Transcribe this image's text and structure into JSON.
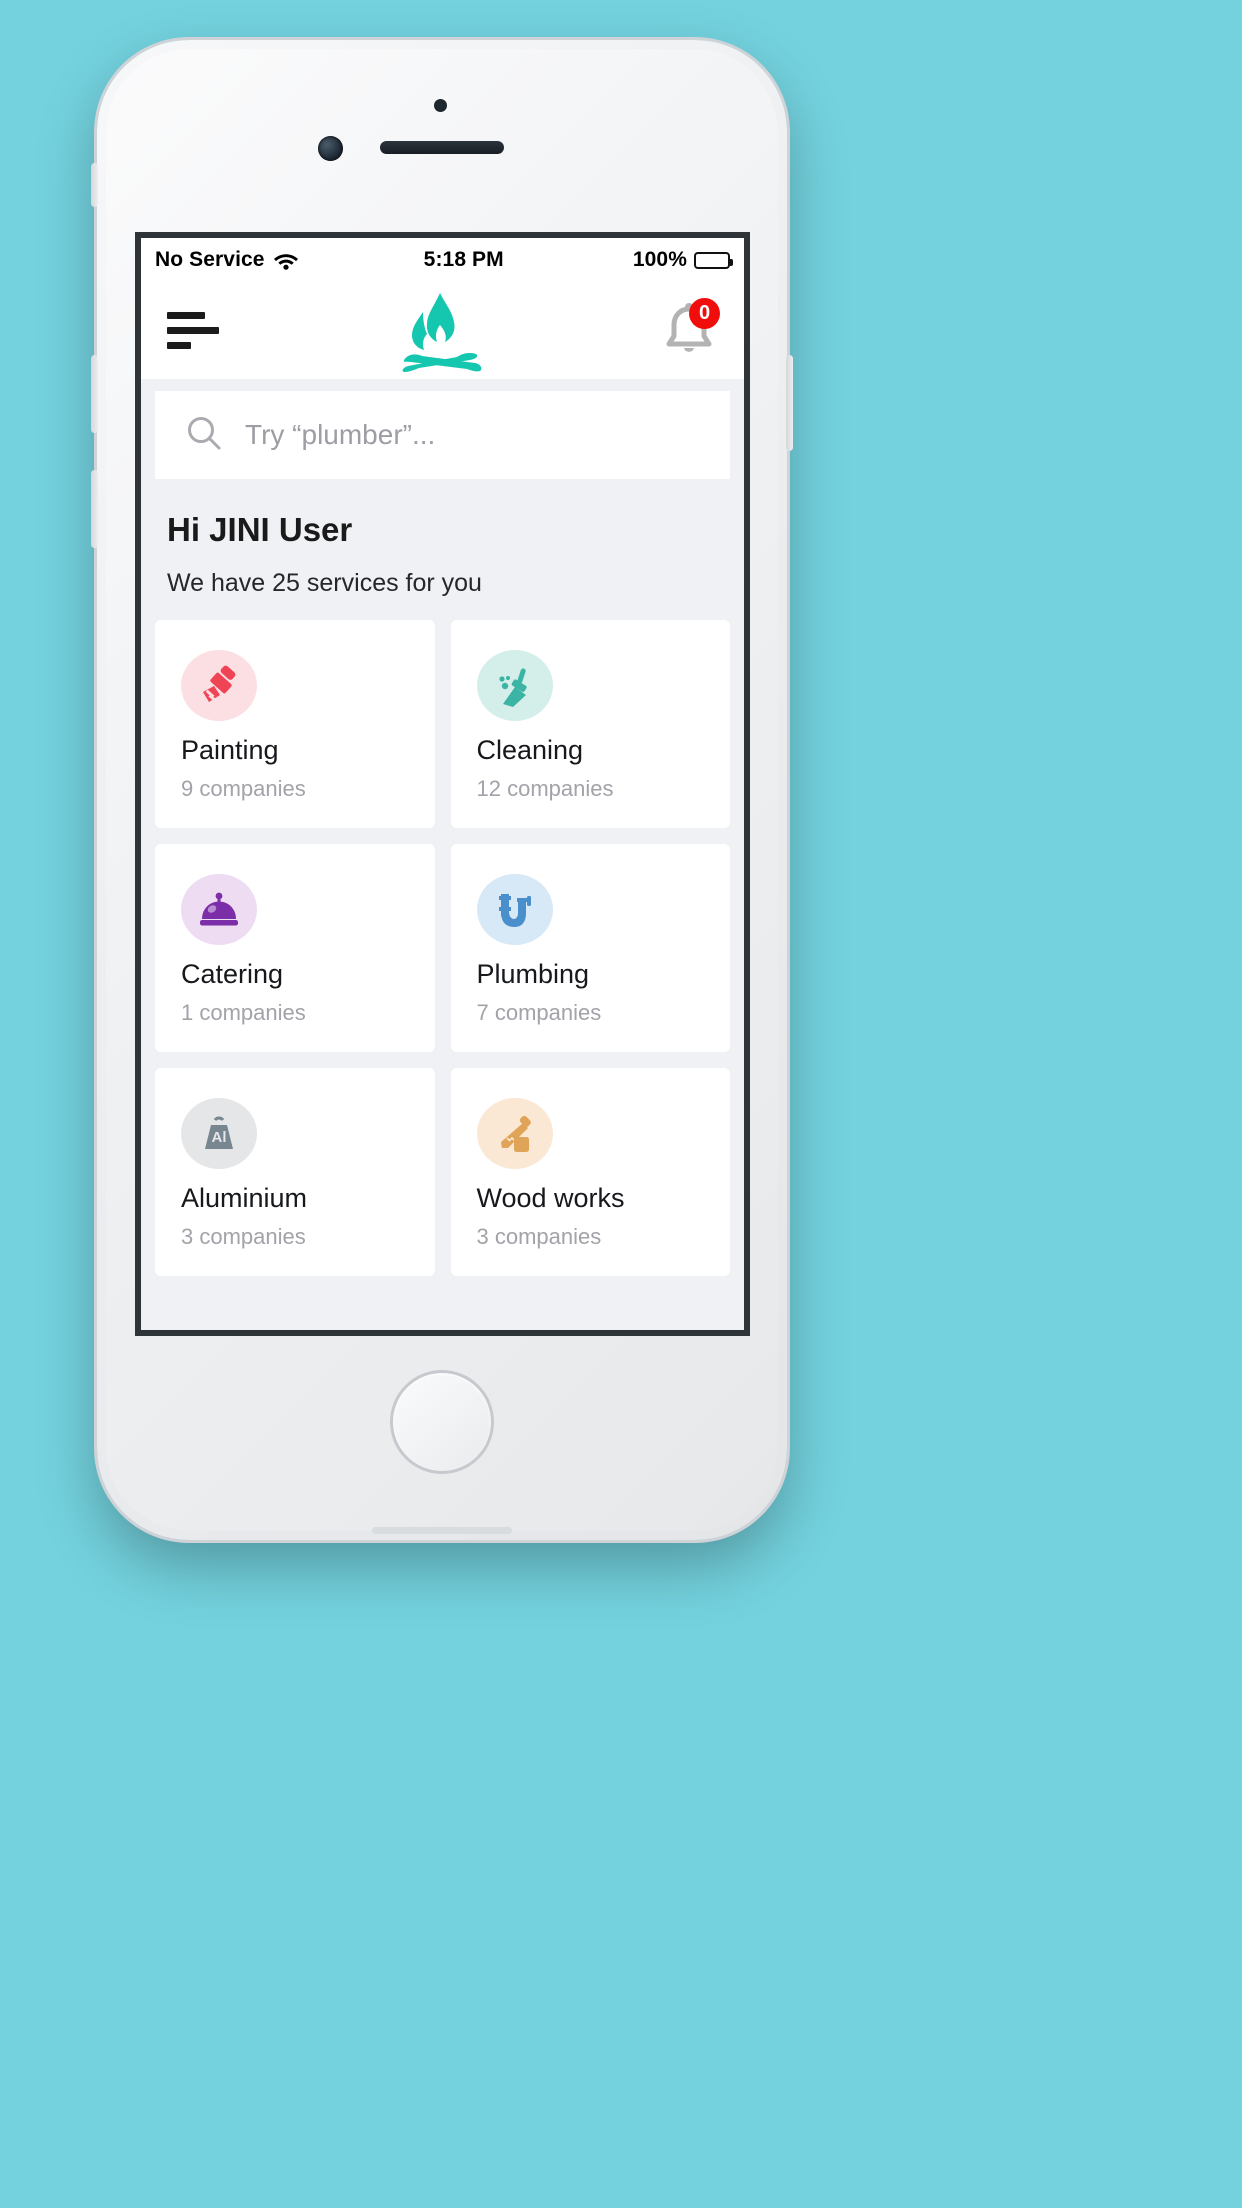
{
  "status_bar": {
    "carrier": "No Service",
    "wifi_icon": "wifi-icon",
    "time": "5:18 PM",
    "battery_percent": "100%",
    "battery_icon": "battery-full-icon"
  },
  "header": {
    "menu_icon": "hamburger-menu-icon",
    "logo_icon": "campfire-logo-icon",
    "bell_icon": "notification-bell-icon",
    "notification_count": "0",
    "accent_color": "#16c7b0",
    "badge_color": "#f20d0d"
  },
  "search": {
    "icon": "search-icon",
    "placeholder": "Try “plumber”..."
  },
  "greeting": {
    "title": "Hi JINI User",
    "subtitle": "We have 25 services for you",
    "service_total": "25"
  },
  "services": [
    {
      "name": "Painting",
      "count": "9 companies",
      "icon": "paint-brush-icon",
      "icon_color": "#ef4455",
      "bg_color": "#fcdfe3"
    },
    {
      "name": "Cleaning",
      "count": "12 companies",
      "icon": "broom-icon",
      "icon_color": "#3bb4a4",
      "bg_color": "#d4efe9"
    },
    {
      "name": "Catering",
      "count": "1 companies",
      "icon": "food-cloche-icon",
      "icon_color": "#7b2ea8",
      "bg_color": "#eedcf2"
    },
    {
      "name": "Plumbing",
      "count": "7 companies",
      "icon": "pipe-icon",
      "icon_color": "#4a8fcc",
      "bg_color": "#d7e8f7"
    },
    {
      "name": "Aluminium",
      "count": "3 companies",
      "icon": "aluminium-weight-icon",
      "icon_color": "#78868f",
      "bg_color": "#e4e6e8"
    },
    {
      "name": "Wood works",
      "count": "3 companies",
      "icon": "saw-icon",
      "icon_color": "#e0a458",
      "bg_color": "#fbe8d4"
    }
  ]
}
